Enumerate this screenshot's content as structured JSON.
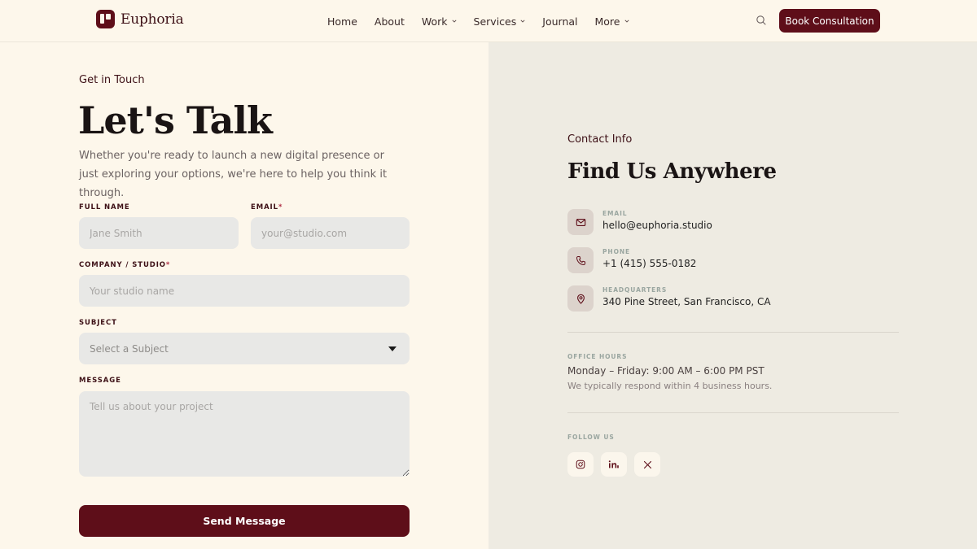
{
  "app": {
    "brand": "Euphoria"
  },
  "nav": {
    "items": [
      {
        "label": "Home",
        "dropdown": false
      },
      {
        "label": "About",
        "dropdown": false
      },
      {
        "label": "Work",
        "dropdown": true
      },
      {
        "label": "Services",
        "dropdown": true
      },
      {
        "label": "Journal",
        "dropdown": false
      },
      {
        "label": "More",
        "dropdown": true
      }
    ],
    "search_icon": "search-icon",
    "cta_label": "Book Consultation"
  },
  "form_section": {
    "eyebrow": "Get in Touch",
    "title": "Let's Talk",
    "intro": "Whether you're ready to launch a new digital presence or just exploring your options, we're here to help you think it through.",
    "fields": {
      "full_name": {
        "label": "Full Name",
        "required": false,
        "placeholder": "Jane Smith"
      },
      "email": {
        "label": "Email",
        "required": true,
        "placeholder": "your@studio.com"
      },
      "company": {
        "label": "Company / Studio",
        "required": true,
        "placeholder": "Your studio name"
      },
      "subject": {
        "label": "Subject",
        "value": "Select a Subject"
      },
      "message": {
        "label": "Message",
        "placeholder": "Tell us about your project"
      }
    },
    "required_mark": "*",
    "submit_label": "Send Message"
  },
  "contact_section": {
    "eyebrow": "Contact Info",
    "title": "Find Us Anywhere",
    "items": [
      {
        "label": "Email",
        "value": "hello@euphoria.studio",
        "icon": "mail-icon"
      },
      {
        "label": "Phone",
        "value": "+1 (415) 555-0182",
        "icon": "phone-icon"
      },
      {
        "label": "Headquarters",
        "value": "340 Pine Street, San Francisco, CA",
        "icon": "map-pin-icon"
      }
    ],
    "office_hours": {
      "label": "Office Hours",
      "hours": "Monday – Friday: 9:00 AM – 6:00 PM PST",
      "note": "We typically respond within 4 business hours."
    },
    "follow": {
      "label": "Follow Us",
      "socials": [
        "instagram-icon",
        "linkedin-icon",
        "x-icon"
      ]
    }
  },
  "colors": {
    "brand": "#5e0e19",
    "background": "#fdf7eb",
    "panel": "#eeebe2",
    "input": "#e8e8e6"
  }
}
